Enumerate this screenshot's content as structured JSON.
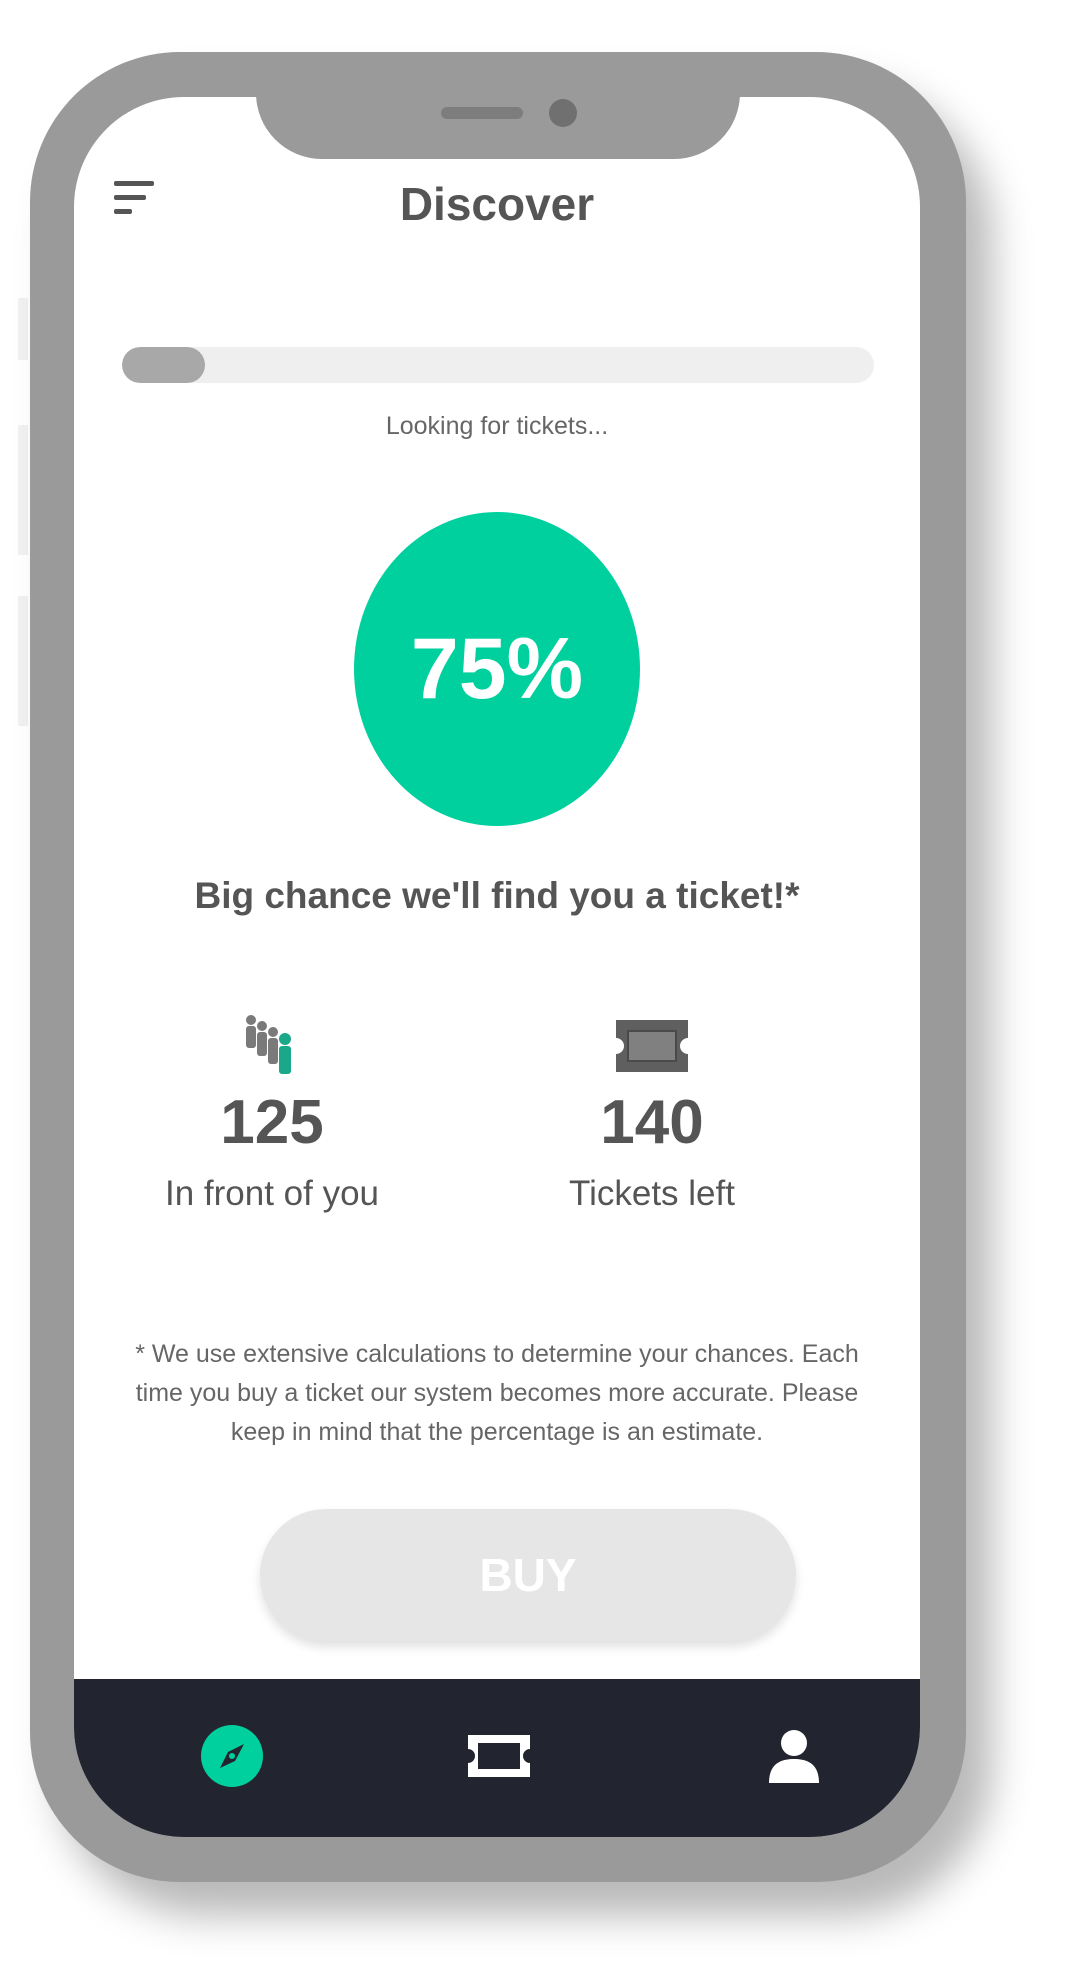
{
  "header": {
    "title": "Discover",
    "menu_icon": "hamburger-menu-icon"
  },
  "progress": {
    "value": 0.11,
    "status_text": "Looking for tickets..."
  },
  "chance": {
    "percent_label": "75%",
    "headline": "Big chance we'll find you a ticket!*",
    "color": "#00d09e"
  },
  "stats": [
    {
      "icon": "queue-people-icon",
      "value": "125",
      "label": "In front of you"
    },
    {
      "icon": "ticket-icon",
      "value": "140",
      "label": "Tickets left"
    }
  ],
  "disclaimer": "* We use extensive calculations to determine your chances. Each time you buy a ticket our system becomes more accurate. Please keep in mind that the percentage is an estimate.",
  "buy_button": {
    "label": "BUY",
    "enabled": false
  },
  "tabbar": {
    "items": [
      {
        "icon": "compass-icon",
        "active": true
      },
      {
        "icon": "ticket-icon",
        "active": false
      },
      {
        "icon": "user-icon",
        "active": false
      }
    ],
    "active_color": "#00d09e",
    "background": "#222530"
  }
}
